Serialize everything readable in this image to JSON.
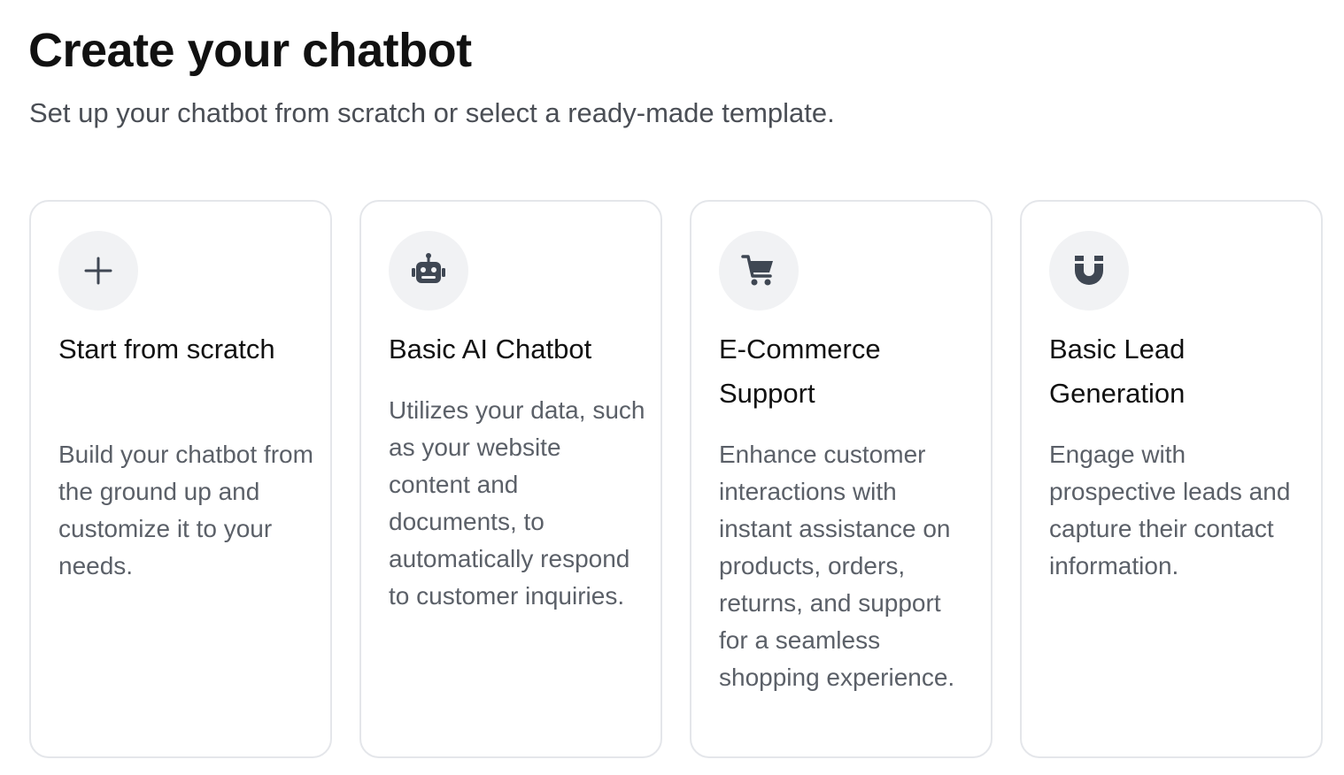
{
  "header": {
    "title": "Create your chatbot",
    "subtitle": "Set up your chatbot from scratch or select a ready-made template."
  },
  "cards": [
    {
      "icon": "plus-icon",
      "title": "Start from scratch",
      "description": "Build your chatbot from the ground up and customize it to your needs."
    },
    {
      "icon": "robot-icon",
      "title": "Basic AI Chatbot",
      "description": "Utilizes your data, such as your website content and documents, to automatically respond to customer inquiries."
    },
    {
      "icon": "shopping-cart-icon",
      "title": "E-Commerce Support",
      "description": "Enhance customer interactions with instant assistance on products, orders, returns, and support for a seamless shopping experience."
    },
    {
      "icon": "magnet-icon",
      "title": "Basic Lead Generation",
      "description": "Engage with prospective leads and capture their contact information."
    }
  ],
  "colors": {
    "icon": "#3f4753",
    "icon_bg": "#f1f2f4",
    "card_border": "#e4e6ea",
    "muted_text": "#5b6068"
  }
}
